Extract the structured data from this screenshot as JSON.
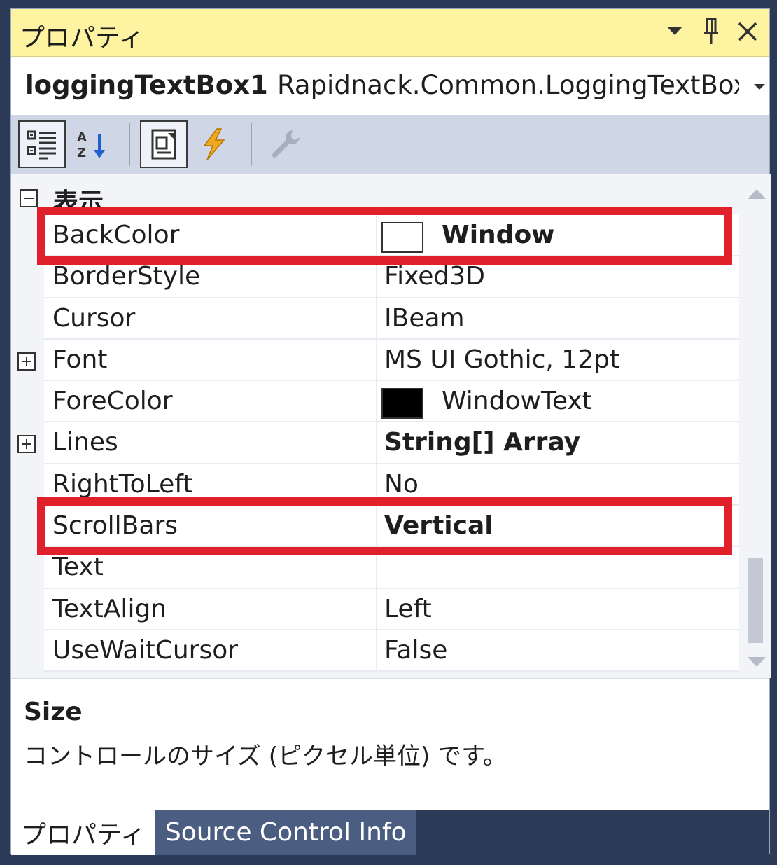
{
  "panel": {
    "title": "プロパティ",
    "icons": [
      "dropdown-arrow-icon",
      "pin-icon",
      "close-icon"
    ]
  },
  "object": {
    "name": "loggingTextBox1",
    "type": "Rapidnack.Common.LoggingTextBox"
  },
  "toolbar": {
    "buttons": [
      "categorized-icon",
      "alphabetical-icon",
      "properties-icon",
      "events-icon",
      "property-pages-icon"
    ]
  },
  "category": {
    "label": "表示",
    "expanded": true
  },
  "properties": [
    {
      "name": "BackColor",
      "value": "Window",
      "bold": true,
      "swatch": "#ffffff",
      "highlight": true
    },
    {
      "name": "BorderStyle",
      "value": "Fixed3D"
    },
    {
      "name": "Cursor",
      "value": "IBeam"
    },
    {
      "name": "Font",
      "value": "MS UI Gothic, 12pt",
      "expandable": true
    },
    {
      "name": "ForeColor",
      "value": "WindowText",
      "swatch": "#000000"
    },
    {
      "name": "Lines",
      "value": "String[] Array",
      "bold": true,
      "expandable": true
    },
    {
      "name": "RightToLeft",
      "value": "No"
    },
    {
      "name": "ScrollBars",
      "value": "Vertical",
      "bold": true,
      "highlight": true
    },
    {
      "name": "Text",
      "value": ""
    },
    {
      "name": "TextAlign",
      "value": "Left"
    },
    {
      "name": "UseWaitCursor",
      "value": "False"
    }
  ],
  "description": {
    "title": "Size",
    "text": "コントロールのサイズ (ピクセル単位) です。"
  },
  "tabs": [
    {
      "label": "プロパティ",
      "active": true
    },
    {
      "label": "Source Control Info",
      "active": false
    }
  ],
  "colors": {
    "highlight": "#e0212b",
    "title_bar": "#fdf3a0",
    "toolbar": "#cfd6e5",
    "background": "#2b3a56"
  }
}
